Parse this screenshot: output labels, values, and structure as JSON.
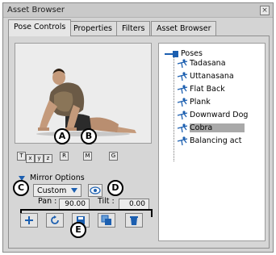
{
  "window": {
    "title": "Asset Browser",
    "close_glyph": "×"
  },
  "tabs": [
    {
      "label": "Pose Controls",
      "active": true
    },
    {
      "label": "Properties",
      "active": false
    },
    {
      "label": "Filters",
      "active": false
    },
    {
      "label": "Asset Browser",
      "active": false
    }
  ],
  "viewport": {
    "figure": "3d-figure-cobra-pose"
  },
  "view_buttons": [
    {
      "label": "T"
    },
    {
      "label": "x"
    },
    {
      "label": "y"
    },
    {
      "label": "z"
    },
    {
      "label": "R"
    },
    {
      "label": "M"
    },
    {
      "label": "G"
    }
  ],
  "tree": {
    "root": "Poses",
    "items": [
      "Tadasana",
      "Uttanasana",
      "Flat Back",
      "Plank",
      "Downward Dog",
      "Cobra",
      "Balancing act"
    ],
    "selected": "Cobra"
  },
  "mirror": {
    "section_label": "Mirror Options",
    "mode": "Custom"
  },
  "pan": {
    "label": "Pan :",
    "value": "90.00"
  },
  "tilt": {
    "label": "Tilt :",
    "value": "0.00"
  },
  "callouts": {
    "a": "A",
    "b": "B",
    "c": "C",
    "d": "D",
    "e": "E"
  },
  "toolbar_icons": [
    "plus-icon",
    "refresh-icon",
    "save-icon",
    "duplicate-icon",
    "trash-icon"
  ],
  "colors": {
    "accent_blue": "#1c5fb0",
    "selection": "#a9a9a9"
  }
}
